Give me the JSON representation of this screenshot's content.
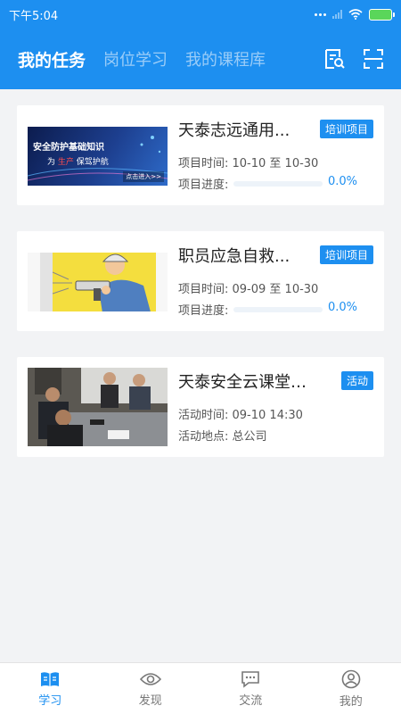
{
  "status_bar": {
    "time": "下午5:04"
  },
  "header": {
    "tabs": [
      {
        "label": "我的任务",
        "active": true
      },
      {
        "label": "岗位学习",
        "active": false
      },
      {
        "label": "我的课程库",
        "active": false
      }
    ],
    "icons": [
      "search-doc-icon",
      "scan-icon"
    ],
    "accent": "#1d8ff0"
  },
  "tasks": [
    {
      "title": "天泰志远通用...",
      "badge": "培训项目",
      "line1": "项目时间: 10-10 至 10-30",
      "progress_label": "项目进度:",
      "progress_value": "0.0%",
      "progress": 0,
      "thumb_text": [
        "安全防护基础知识",
        "为 ",
        "生产",
        " 保驾护航",
        "点击进入>>"
      ]
    },
    {
      "title": "职员应急自救...",
      "badge": "培训项目",
      "line1": "项目时间: 09-09 至 10-30",
      "progress_label": "项目进度:",
      "progress_value": "0.0%",
      "progress": 0
    },
    {
      "title": "天泰安全云课堂图...",
      "badge": "活动",
      "line1": "活动时间: 09-10 14:30",
      "line2": "活动地点: 总公司"
    }
  ],
  "bottom_nav": [
    {
      "label": "学习",
      "icon": "book-icon",
      "active": true
    },
    {
      "label": "发现",
      "icon": "eye-icon",
      "active": false
    },
    {
      "label": "交流",
      "icon": "chat-icon",
      "active": false
    },
    {
      "label": "我的",
      "icon": "user-icon",
      "active": false
    }
  ]
}
